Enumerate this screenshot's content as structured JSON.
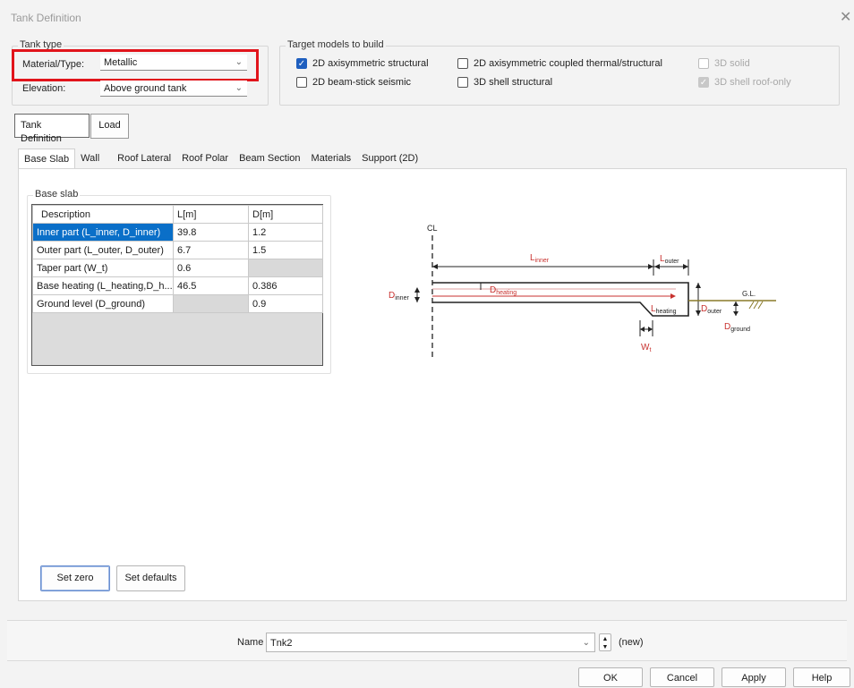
{
  "window": {
    "title": "Tank Definition",
    "close": "✕"
  },
  "tank_type": {
    "label": "Tank type",
    "material_label": "Material/Type:",
    "material_value": "Metallic",
    "elevation_label": "Elevation:",
    "elevation_value": "Above ground tank"
  },
  "target_models": {
    "label": "Target models to build",
    "options": [
      {
        "label": "2D axisymmetric structural",
        "checked": true,
        "enabled": true
      },
      {
        "label": "2D axisymmetric coupled thermal/structural",
        "checked": false,
        "enabled": true
      },
      {
        "label": "3D solid",
        "checked": false,
        "enabled": false
      },
      {
        "label": "2D beam-stick seismic",
        "checked": false,
        "enabled": true
      },
      {
        "label": "3D shell structural",
        "checked": false,
        "enabled": true
      },
      {
        "label": "3D shell roof-only",
        "checked": true,
        "enabled": false
      }
    ]
  },
  "main_tabs": [
    "Tank Definition",
    "Load"
  ],
  "sub_tabs": [
    "Base Slab",
    "Wall",
    "Roof Lateral",
    "Roof Polar",
    "Beam Section",
    "Materials",
    "Support (2D)"
  ],
  "base_slab": {
    "group_label": "Base slab",
    "columns": [
      "Description",
      "L[m]",
      "D[m]"
    ],
    "rows": [
      {
        "desc": "Inner part (L_inner, D_inner)",
        "L": "39.8",
        "D": "1.2"
      },
      {
        "desc": "Outer part (L_outer, D_outer)",
        "L": "6.7",
        "D": "1.5"
      },
      {
        "desc": "Taper part (W_t)",
        "L": "0.6",
        "D": ""
      },
      {
        "desc": "Base heating (L_heating,D_h...",
        "L": "46.5",
        "D": "0.386"
      },
      {
        "desc": "Ground level (D_ground)",
        "L": "",
        "D": "0.9"
      }
    ]
  },
  "diagram": {
    "cl": "CL",
    "gl": "G.L.",
    "L_inner": {
      "main": "L",
      "sub": "inner"
    },
    "L_outer": {
      "main": "L",
      "sub": "outer"
    },
    "D_inner": {
      "main": "D",
      "sub": "inner"
    },
    "D_heating": {
      "main": "D",
      "sub": "heating"
    },
    "L_heating": {
      "main": "L",
      "sub": "heating"
    },
    "D_outer": {
      "main": "D",
      "sub": "outer"
    },
    "D_ground": {
      "main": "D",
      "sub": "ground"
    },
    "W_t": {
      "main": "W",
      "sub": "t"
    }
  },
  "buttons": {
    "set_zero": "Set zero",
    "set_defaults": "Set defaults"
  },
  "footer": {
    "name_label": "Name",
    "name_value": "Tnk2",
    "new_label": "(new)"
  },
  "dialog_buttons": {
    "ok": "OK",
    "cancel": "Cancel",
    "apply": "Apply",
    "help": "Help"
  },
  "colors": {
    "highlight": "#e1141b",
    "selection": "#0a6fc8",
    "diagram_red": "#c8322f",
    "ground": "#8a7a2a"
  }
}
